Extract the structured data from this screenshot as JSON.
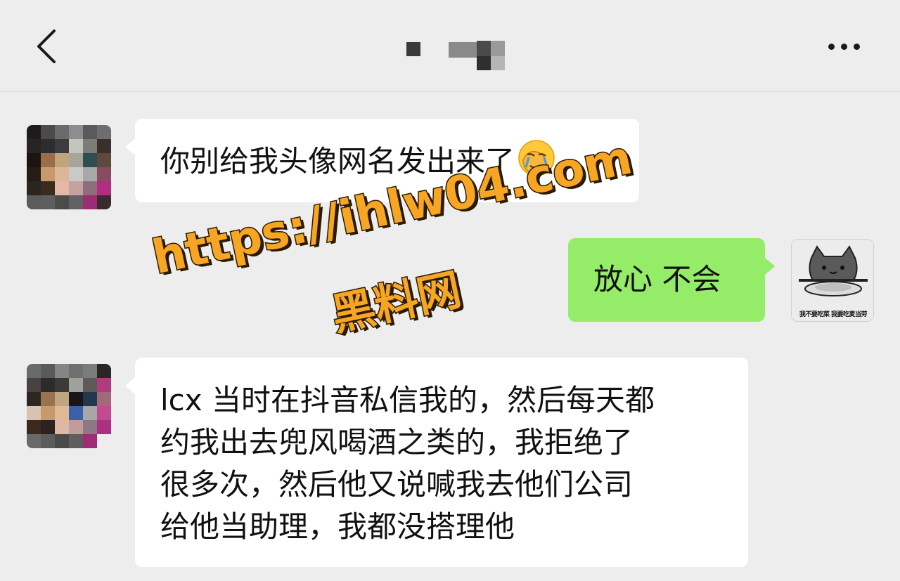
{
  "header": {
    "back_label": "back",
    "title": "",
    "more_label": "more"
  },
  "colors": {
    "background": "#ededed",
    "incoming_bubble": "#ffffff",
    "outgoing_bubble": "#95ec69",
    "watermark": "#f6a623"
  },
  "messages": [
    {
      "direction": "incoming",
      "text": "你别给我头像网名发出来了",
      "emoji": "face-with-hand-over-face-crying-icon"
    },
    {
      "direction": "outgoing",
      "text": "放心 不会",
      "avatar_caption": "我不要吃菜 我要吃麦当劳"
    },
    {
      "direction": "incoming",
      "lines": [
        "lcx 当时在抖音私信我的，然后每天都",
        "约我出去兜风喝酒之类的，我拒绝了",
        "很多次，然后他又说喊我去他们公司",
        "给他当助理，我都没搭理他"
      ]
    }
  ],
  "watermark": {
    "url": "https://ihlw04.com",
    "name": "黑料网"
  }
}
